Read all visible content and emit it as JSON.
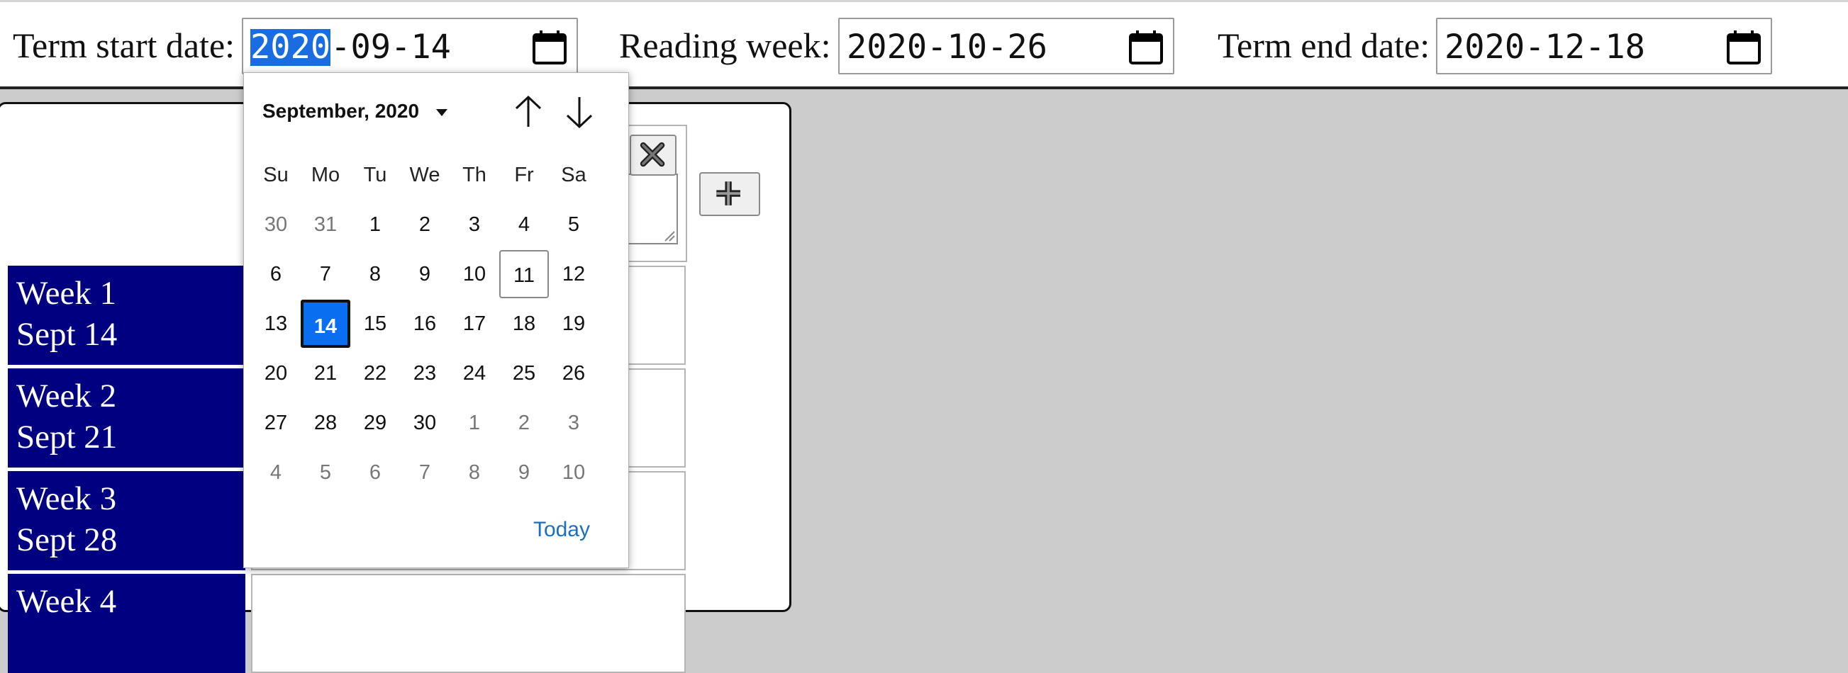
{
  "toolbar": {
    "term_start": {
      "label": "Term start date:",
      "year": "2020",
      "rest": "-09-14"
    },
    "reading_week": {
      "label": "Reading week:",
      "value": "2020-10-26"
    },
    "term_end": {
      "label": "Term end date:",
      "value": "2020-12-18"
    }
  },
  "weeks": [
    {
      "line1": "Week 1",
      "line2": "Sept 14"
    },
    {
      "line1": "Week 2",
      "line2": "Sept 21"
    },
    {
      "line1": "Week 3",
      "line2": "Sept 28"
    },
    {
      "line1": "Week 4",
      "line2": ""
    }
  ],
  "picker": {
    "month_label": "September, 2020",
    "today_label": "Today",
    "weekdays": [
      "Su",
      "Mo",
      "Tu",
      "We",
      "Th",
      "Fr",
      "Sa"
    ],
    "days": [
      [
        "30",
        "31",
        "1",
        "2",
        "3",
        "4",
        "5"
      ],
      [
        "6",
        "7",
        "8",
        "9",
        "10",
        "11",
        "12"
      ],
      [
        "13",
        "14",
        "15",
        "16",
        "17",
        "18",
        "19"
      ],
      [
        "20",
        "21",
        "22",
        "23",
        "24",
        "25",
        "26"
      ],
      [
        "27",
        "28",
        "29",
        "30",
        "1",
        "2",
        "3"
      ],
      [
        "4",
        "5",
        "6",
        "7",
        "8",
        "9",
        "10"
      ]
    ],
    "selected_day": "14",
    "today_day": "11"
  },
  "icons": {
    "calendar": "calendar-icon",
    "remove": "close-icon",
    "add": "plus-icon",
    "prev": "arrow-up-icon",
    "next": "arrow-down-icon"
  },
  "colors": {
    "week_bg": "#000080",
    "selected_day": "#0a6ef0",
    "today_link": "#1a6fc0",
    "background": "#cccccc"
  }
}
